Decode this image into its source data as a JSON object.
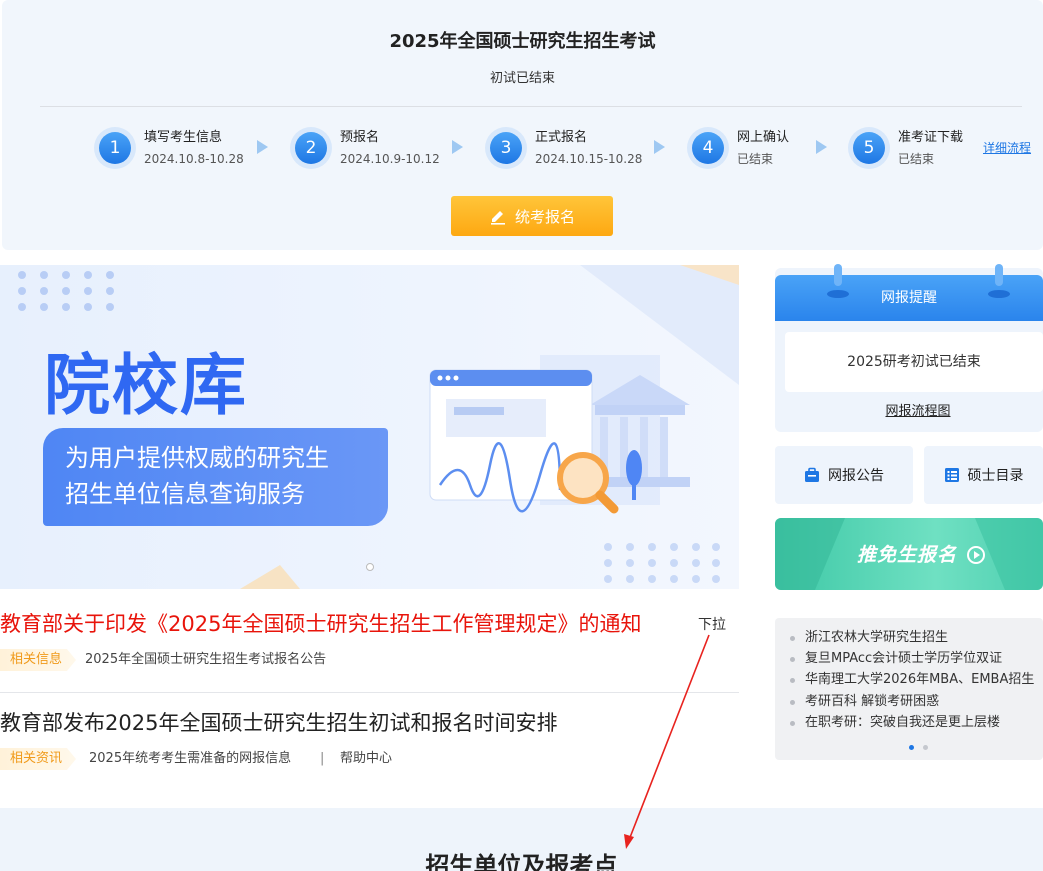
{
  "exam": {
    "title": "2025年全国硕士研究生招生考试",
    "status": "初试已结束",
    "steps": [
      {
        "num": "1",
        "name": "填写考生信息",
        "date": "2024.10.8-10.28"
      },
      {
        "num": "2",
        "name": "预报名",
        "date": "2024.10.9-10.12"
      },
      {
        "num": "3",
        "name": "正式报名",
        "date": "2024.10.15-10.28"
      },
      {
        "num": "4",
        "name": "网上确认",
        "date": "已结束"
      },
      {
        "num": "5",
        "name": "准考证下载",
        "date": "已结束"
      }
    ],
    "detail_link": "详细流程",
    "register_button": "统考报名"
  },
  "banner": {
    "title": "院校库",
    "line1": "为用户提供权威的研究生",
    "line2": "招生单位信息查询服务"
  },
  "news": [
    {
      "title": "教育部关于印发《2025年全国硕士研究生招生工作管理规定》的通知",
      "tag": "相关信息",
      "links": [
        "2025年全国硕士研究生招生考试报名公告"
      ]
    },
    {
      "title": "教育部发布2025年全国硕士研究生招生初试和报名时间安排",
      "tag": "相关资讯",
      "links": [
        "2025年统考考生需准备的网报信息",
        "帮助中心"
      ],
      "separator": "|"
    }
  ],
  "annotation": {
    "label": "下拉",
    "color": "#e8231f"
  },
  "reminder": {
    "header": "网报提醒",
    "message": "2025研考初试已结束",
    "link": "网报流程图"
  },
  "quick_links": [
    {
      "label": "网报公告",
      "icon": "bag-icon"
    },
    {
      "label": "硕士目录",
      "icon": "list-icon"
    }
  ],
  "tuimian_banner": "推免生报名",
  "side_links": [
    "浙江农林大学研究生招生",
    "复旦MPAcc会计硕士学历学位双证",
    "华南理工大学2026年MBA、EMBA招生",
    "考研百科 解锁考研困惑",
    "在职考研：突破自我还是更上层楼"
  ],
  "bottom_title": "招生单位及报考点",
  "colors": {
    "primary": "#1e77e4",
    "accent": "#fda812",
    "news_red": "#e8140b"
  }
}
